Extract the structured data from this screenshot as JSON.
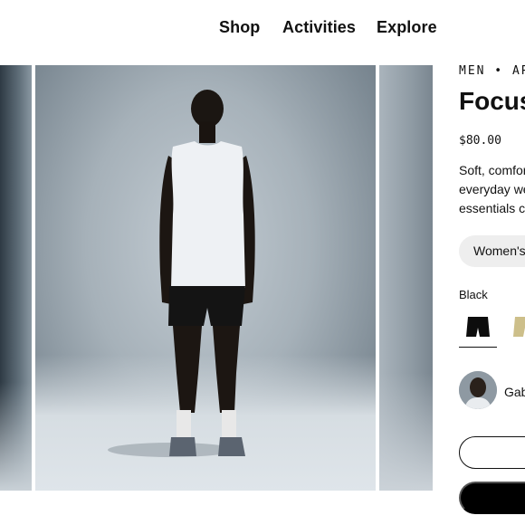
{
  "nav": {
    "items": [
      {
        "label": "Shop"
      },
      {
        "label": "Activities"
      },
      {
        "label": "Explore"
      }
    ]
  },
  "product": {
    "eyebrow": "MEN • AP",
    "title": "Focus",
    "price": "$80.00",
    "description_lines": [
      "Soft, comfor",
      "everyday we",
      "essentials cl"
    ],
    "gender_selected": "Women's",
    "color_label": "Black",
    "swatches": [
      {
        "name": "black",
        "color": "#0d0d0d",
        "selected": true
      },
      {
        "name": "tan",
        "color": "#cdbf8a",
        "selected": false
      }
    ],
    "reviewer_name": "Gab",
    "buttons": {
      "outline_label": "",
      "solid_label": ""
    }
  },
  "gallery": {
    "slides": [
      "left-partial",
      "main",
      "right-partial"
    ],
    "subject": {
      "tank_color": "#eef1f4",
      "shorts_color": "#141414",
      "sock_color": "#e8e8e8",
      "shoe_color": "#5b6470"
    }
  }
}
